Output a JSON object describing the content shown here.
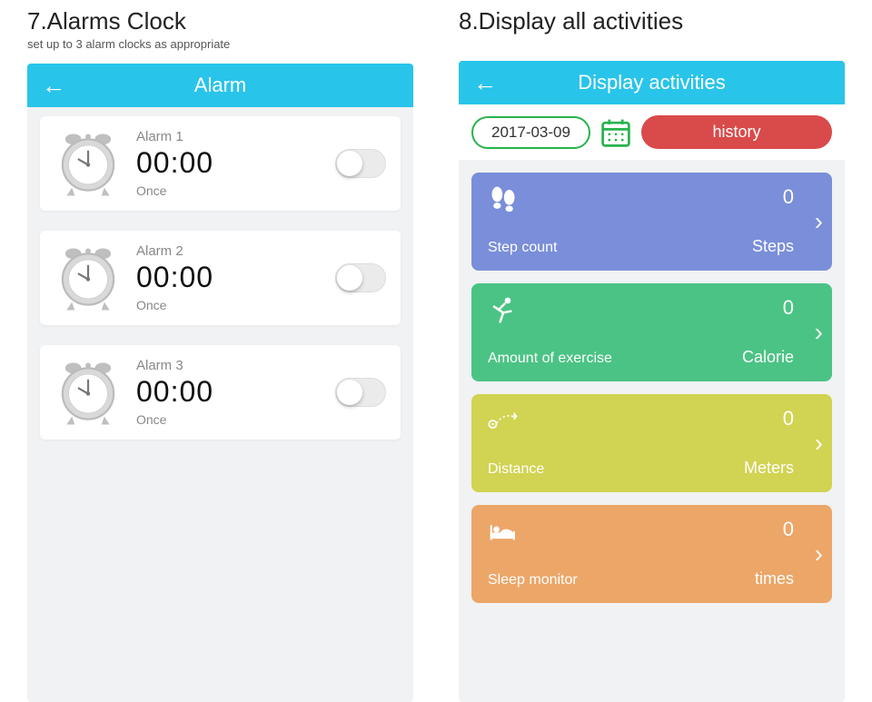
{
  "section7": {
    "title": "7.Alarms Clock",
    "subtitle": "set up to 3 alarm clocks as appropriate",
    "header": "Alarm",
    "alarms": [
      {
        "name": "Alarm 1",
        "time": "00:00",
        "repeat": "Once"
      },
      {
        "name": "Alarm 2",
        "time": "00:00",
        "repeat": "Once"
      },
      {
        "name": "Alarm 3",
        "time": "00:00",
        "repeat": "Once"
      }
    ]
  },
  "section8": {
    "title": "8.Display all activities",
    "header": "Display activities",
    "date": "2017-03-09",
    "history_label": "history",
    "cards": [
      {
        "label": "Step count",
        "value": "0",
        "unit": "Steps"
      },
      {
        "label": "Amount of exercise",
        "value": "0",
        "unit": "Calorie"
      },
      {
        "label": "Distance",
        "value": "0",
        "unit": "Meters"
      },
      {
        "label": "Sleep monitor",
        "value": "0",
        "unit": "times"
      }
    ]
  }
}
